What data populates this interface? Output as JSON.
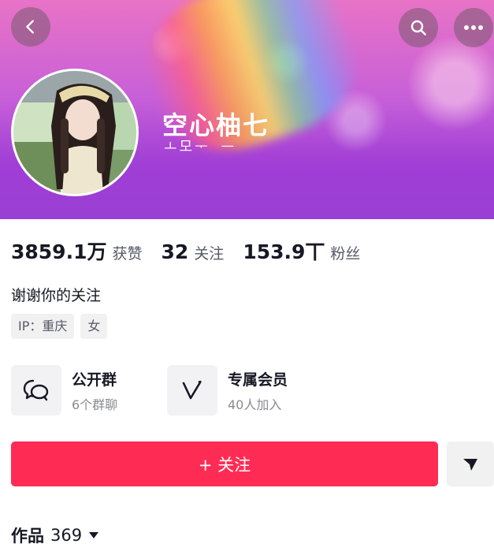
{
  "profile": {
    "nickname": "空心柚七",
    "nickname_echo": "ㅗ모ᅮ ᅳ"
  },
  "stats": [
    {
      "value": "3859.1万",
      "label": "获赞"
    },
    {
      "value": "32",
      "label": "关注"
    },
    {
      "value": "153.9丅",
      "label": "粉丝"
    }
  ],
  "bio": "谢谢你的关注",
  "tags": [
    "IP：重庆",
    "女"
  ],
  "features": {
    "group": {
      "title": "公开群",
      "subtitle": "6个群聊",
      "icon": "group-chat-icon"
    },
    "member": {
      "title": "专属会员",
      "subtitle": "40人加入",
      "icon": "vip-icon"
    }
  },
  "actions": {
    "follow_label": "+ 关注",
    "dropdown_icon": "triangle-down-icon"
  },
  "works": {
    "label": "作品",
    "count": "369"
  },
  "colors": {
    "accent": "#fe2c55",
    "banner_top": "#e873c6",
    "banner_bottom": "#9a3fd3"
  }
}
